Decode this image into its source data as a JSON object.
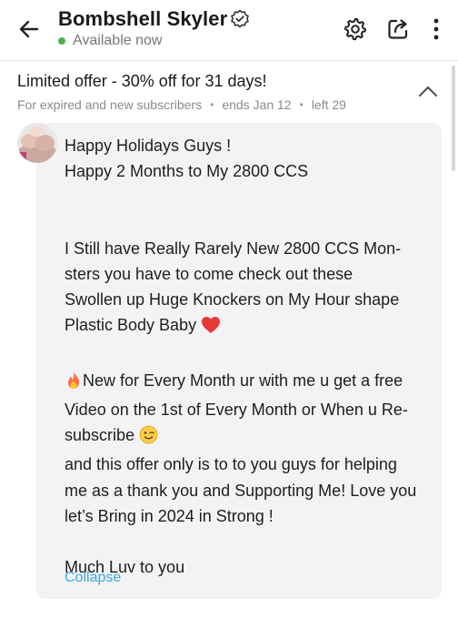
{
  "header": {
    "title": "Bombshell Skyler",
    "status": "Available now",
    "status_color": "#4caf50",
    "icons": [
      "back-arrow-icon",
      "verified-icon",
      "gear-icon",
      "share-icon",
      "more-vertical-icon"
    ]
  },
  "offer": {
    "title": "Limited offer - 30% off for 31 days!",
    "audience": "For expired and new subscribers",
    "ends": "ends Jan 12",
    "left": "left 29"
  },
  "message": {
    "line1": "Happy Holidays Guys !",
    "line2": "Happy 2 Months to My 2800 CCS",
    "line3": "I Still have Really Rarely New 2800 CCS Mon-",
    "line4": "sters you have to come check out these",
    "line5": "Swollen up Huge Knockers on My Hour shape",
    "line6": "Plastic Body Baby",
    "line7": "New for Every Month ur with me u get a free",
    "line8": "Video on the 1st of Every Month or When u Re-",
    "line9": "subscribe",
    "line10": "and this offer only is to to you guys for helping",
    "line11": "me as a thank you and Supporting Me! Love you",
    "line12": "let’s Bring in 2024 in Strong !",
    "line13": "Much Luv to you",
    "emojis": [
      "heart-emoji",
      "fire-emoji",
      "wink-emoji"
    ]
  },
  "collapse_label": "Collapse",
  "colors": {
    "accent_link": "#3aa7e6",
    "bubble_bg": "#f3f3f5",
    "heart": "#e53935"
  }
}
